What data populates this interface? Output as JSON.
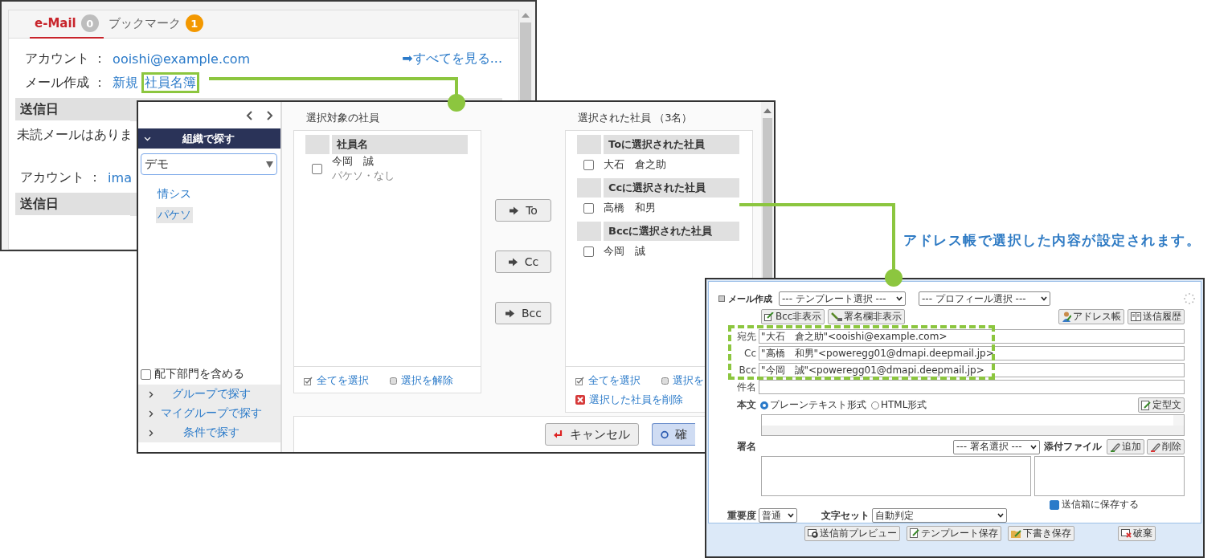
{
  "email_widget": {
    "tabs": [
      {
        "label": "e-Mail",
        "badge": "0",
        "color": "#bdbdbd",
        "selected": true
      },
      {
        "label": "ブックマーク",
        "badge": "1",
        "color": "#f39800",
        "selected": false
      }
    ],
    "account_label": "アカウント ：",
    "account": "ooishi@example.com",
    "see_all": "➡すべてを見る...",
    "compose_label": "メール作成 ：",
    "compose_links": [
      "新規",
      "社員名簿"
    ],
    "table_header": "送信日",
    "message": "未読メールはありま",
    "account2_label": "アカウント ：",
    "account2": "ima",
    "table2_header": "送信日"
  },
  "picker_dialog": {
    "sidebar": {
      "section": {
        "label": "組織で探す",
        "expanded": true
      },
      "organization": "デモ",
      "departments": [
        {
          "label": "情シス",
          "selected": false
        },
        {
          "label": "パケソ",
          "selected": true
        }
      ],
      "include_subdepartments": {
        "label": "配下部門を含める",
        "checked": false
      },
      "other_searches": [
        {
          "label": "グループで探す",
          "expanded": false
        },
        {
          "label": "マイグループで探す",
          "expanded": false
        },
        {
          "label": "条件で探す",
          "expanded": false
        }
      ]
    },
    "candidates": {
      "title": "選択対象の社員",
      "column": "社員名",
      "rows": [
        {
          "name": "今岡　誠",
          "department": "パケソ・なし",
          "checked": false
        }
      ],
      "select_all": "全てを選択",
      "deselect": "選択を解除"
    },
    "add_buttons": [
      "To",
      "Cc",
      "Bcc"
    ],
    "selected": {
      "title": "選択された社員 （3名）",
      "groups": [
        {
          "heading": "Toに選択された社員",
          "members": [
            {
              "name": "大石　倉之助",
              "checked": false
            }
          ]
        },
        {
          "heading": "Ccに選択された社員",
          "members": [
            {
              "name": "高橋　和男",
              "checked": false
            }
          ]
        },
        {
          "heading": "Bccに選択された社員",
          "members": [
            {
              "name": "今岡　誠",
              "checked": false
            }
          ]
        }
      ],
      "select_all": "全てを選択",
      "deselect": "選択を",
      "remove": "選択した社員を削除"
    },
    "buttons": [
      {
        "label": "キャンセル",
        "kind": "cancel"
      },
      {
        "label": "確",
        "kind": "confirm"
      }
    ]
  },
  "compose": {
    "title": "メール作成",
    "template_select": "--- テンプレート選択 ---",
    "profile_select": "--- プロフィール選択 ---",
    "toolbar_left": [
      "Bcc非表示",
      "署名欄非表示"
    ],
    "toolbar_right": [
      "アドレス帳",
      "送信履歴"
    ],
    "address_fields": [
      {
        "label": "宛先",
        "value": "\"大石　倉之助\"<ooishi@example.com>"
      },
      {
        "label": "Cc",
        "value": "\"高橋　和男\"<poweregg01@dmapi.deepmail.jp>"
      },
      {
        "label": "Bcc",
        "value": "\"今岡　誠\"<poweregg01@dmapi.deepmail.jp>"
      }
    ],
    "subject_label": "件名",
    "body_label": "本文",
    "formats": [
      {
        "label": "プレーンテキスト形式",
        "selected": true
      },
      {
        "label": "HTML形式",
        "selected": false
      }
    ],
    "fixed_phrase_button": "定型文",
    "signature_label": "署名",
    "signature_select": "--- 署名選択 ---",
    "attachment_label": "添付ファイル",
    "attachment_buttons": [
      "追加",
      "削除"
    ],
    "save_to_outbox": {
      "label": "送信箱に保存する",
      "checked": true
    },
    "importance_label": "重要度",
    "importance": "普通",
    "charset_label": "文字セット",
    "charset": "自動判定",
    "footer_buttons": [
      "送信前プレビュー",
      "テンプレート保存",
      "下書き保存",
      "破棄"
    ]
  },
  "callout": "アドレス帳で選択した内容が設定されます。"
}
